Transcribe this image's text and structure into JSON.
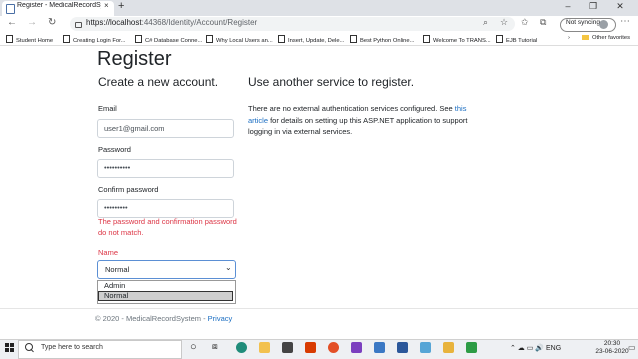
{
  "browser": {
    "tab_title": "Register - MedicalRecordSystem",
    "tab_close": "×",
    "new_tab": "+",
    "url_host": "https://localhost",
    "url_rest": ":44368/Identity/Account/Register",
    "sync_label": "Not syncing",
    "bookmarks": [
      {
        "label": "Student Home",
        "type": "page"
      },
      {
        "label": "Creating Login For...",
        "type": "page"
      },
      {
        "label": "C# Database Conne...",
        "type": "page"
      },
      {
        "label": "Why Local Users an...",
        "type": "page"
      },
      {
        "label": "Insert, Update, Dele...",
        "type": "page"
      },
      {
        "label": "Best Python Online...",
        "type": "page"
      },
      {
        "label": "Welcome To TRANS...",
        "type": "page"
      },
      {
        "label": "EJB Tutorial",
        "type": "page"
      },
      {
        "label": "Other favorites",
        "type": "folder"
      }
    ]
  },
  "page": {
    "title": "Register",
    "subtitle_left": "Create a new account.",
    "subtitle_right": "Use another service to register.",
    "email_label": "Email",
    "email_value": "user1@gmail.com",
    "password_label": "Password",
    "password_value": "••••••••••",
    "confirm_label": "Confirm password",
    "confirm_value": "•••••••••",
    "error_message": "The password and confirmation password do not match.",
    "name_label": "Name",
    "name_selected": "Normal",
    "name_options": [
      "Admin",
      "Normal"
    ],
    "external_text_1": "There are no external authentication services configured. See ",
    "external_link": "this article",
    "external_text_2": " for details on setting up this ASP.NET application to support logging in via external services.",
    "footer_text": "© 2020 - MedicalRecordSystem - ",
    "footer_link": "Privacy"
  },
  "taskbar": {
    "search_placeholder": "Type here to search",
    "tray_language": "ENG",
    "time": "20:30",
    "date": "23-06-2020"
  },
  "colors": {
    "error": "#dc3545",
    "link": "#1b6ec2",
    "focus_border": "#5b8fd4"
  }
}
